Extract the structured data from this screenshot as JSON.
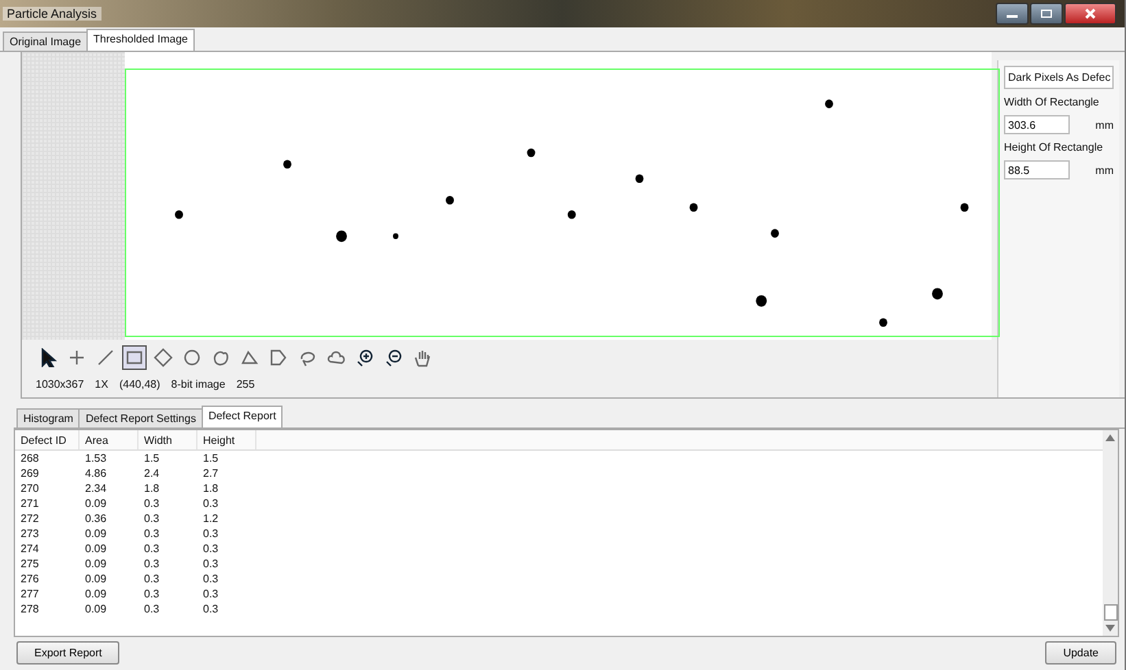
{
  "window": {
    "title": "Particle Analysis"
  },
  "image_tabs": [
    {
      "label": "Original Image",
      "selected": false
    },
    {
      "label": "Thresholded Image",
      "selected": true
    }
  ],
  "tools": [
    {
      "kind": "pointer",
      "selected": false
    },
    {
      "kind": "crosshair",
      "selected": false
    },
    {
      "kind": "line",
      "selected": false
    },
    {
      "kind": "rectangle",
      "selected": true
    },
    {
      "kind": "diamond",
      "selected": false
    },
    {
      "kind": "circle",
      "selected": false
    },
    {
      "kind": "blob",
      "selected": false
    },
    {
      "kind": "polygon",
      "selected": false
    },
    {
      "kind": "tag",
      "selected": false
    },
    {
      "kind": "lasso",
      "selected": false
    },
    {
      "kind": "cloud",
      "selected": false
    },
    {
      "kind": "zoom-in",
      "selected": false
    },
    {
      "kind": "zoom-out",
      "selected": false
    },
    {
      "kind": "hand",
      "selected": false
    }
  ],
  "image_status": [
    "1030x367",
    "1X",
    "(440,48)",
    "8-bit image",
    "255"
  ],
  "settings": {
    "mode": "Dark Pixels As Defec",
    "width_label": "Width Of Rectangle",
    "width_value": "303.6",
    "width_unit": "mm",
    "height_label": "Height Of Rectangle",
    "height_value": "88.5",
    "height_unit": "mm"
  },
  "report_tabs": [
    {
      "label": "Histogram",
      "selected": false
    },
    {
      "label": "Defect Report Settings",
      "selected": false
    },
    {
      "label": "Defect Report",
      "selected": true
    }
  ],
  "table": {
    "columns": [
      "Defect ID",
      "Area",
      "Width",
      "Height"
    ],
    "rows": [
      [
        "268",
        "1.53",
        "1.5",
        "1.5"
      ],
      [
        "269",
        "4.86",
        "2.4",
        "2.7"
      ],
      [
        "270",
        "2.34",
        "1.8",
        "1.8"
      ],
      [
        "271",
        "0.09",
        "0.3",
        "0.3"
      ],
      [
        "272",
        "0.36",
        "0.3",
        "1.2"
      ],
      [
        "273",
        "0.09",
        "0.3",
        "0.3"
      ],
      [
        "274",
        "0.09",
        "0.3",
        "0.3"
      ],
      [
        "275",
        "0.09",
        "0.3",
        "0.3"
      ],
      [
        "276",
        "0.09",
        "0.3",
        "0.3"
      ],
      [
        "277",
        "0.09",
        "0.3",
        "0.3"
      ],
      [
        "278",
        "0.09",
        "0.3",
        "0.3"
      ]
    ]
  },
  "buttons": {
    "export": "Export Report",
    "update": "Update"
  }
}
